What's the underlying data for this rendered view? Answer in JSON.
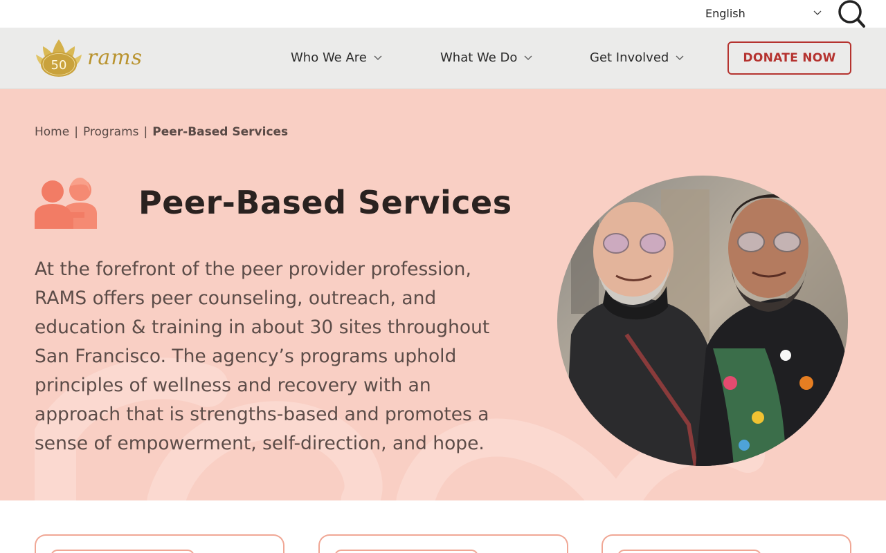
{
  "topbar": {
    "language": "English",
    "language_icon": "chevron-down-icon",
    "search_icon": "search-icon"
  },
  "nav": {
    "logo_badge": "50",
    "logo_wordmark": "rams",
    "items": [
      {
        "label": "Who We Are",
        "icon": "chevron-down-icon"
      },
      {
        "label": "What We Do",
        "icon": "chevron-down-icon"
      },
      {
        "label": "Get Involved",
        "icon": "chevron-down-icon"
      }
    ],
    "donate_label": "DONATE NOW"
  },
  "breadcrumb": {
    "home": "Home",
    "programs": "Programs",
    "current": "Peer-Based Services",
    "separator": "|"
  },
  "hero": {
    "icon": "peer-people-icon",
    "title": "Peer-Based Services",
    "body": "At the forefront of the peer provider profession, RAMS offers peer counseling, outreach, and education & training in about 30 sites throughout San Francisco. The agency’s programs uphold principles of wellness and recovery with an approach that is strengths-based and promotes a sense of empowerment, self-direction, and hope."
  },
  "colors": {
    "hero_bg": "#f9cfc4",
    "accent_red": "#b5332f",
    "icon_coral": "#f58a73",
    "logo_gold": "#c9a23c",
    "nav_bg": "#ebebea",
    "card_border": "#f0a795"
  }
}
